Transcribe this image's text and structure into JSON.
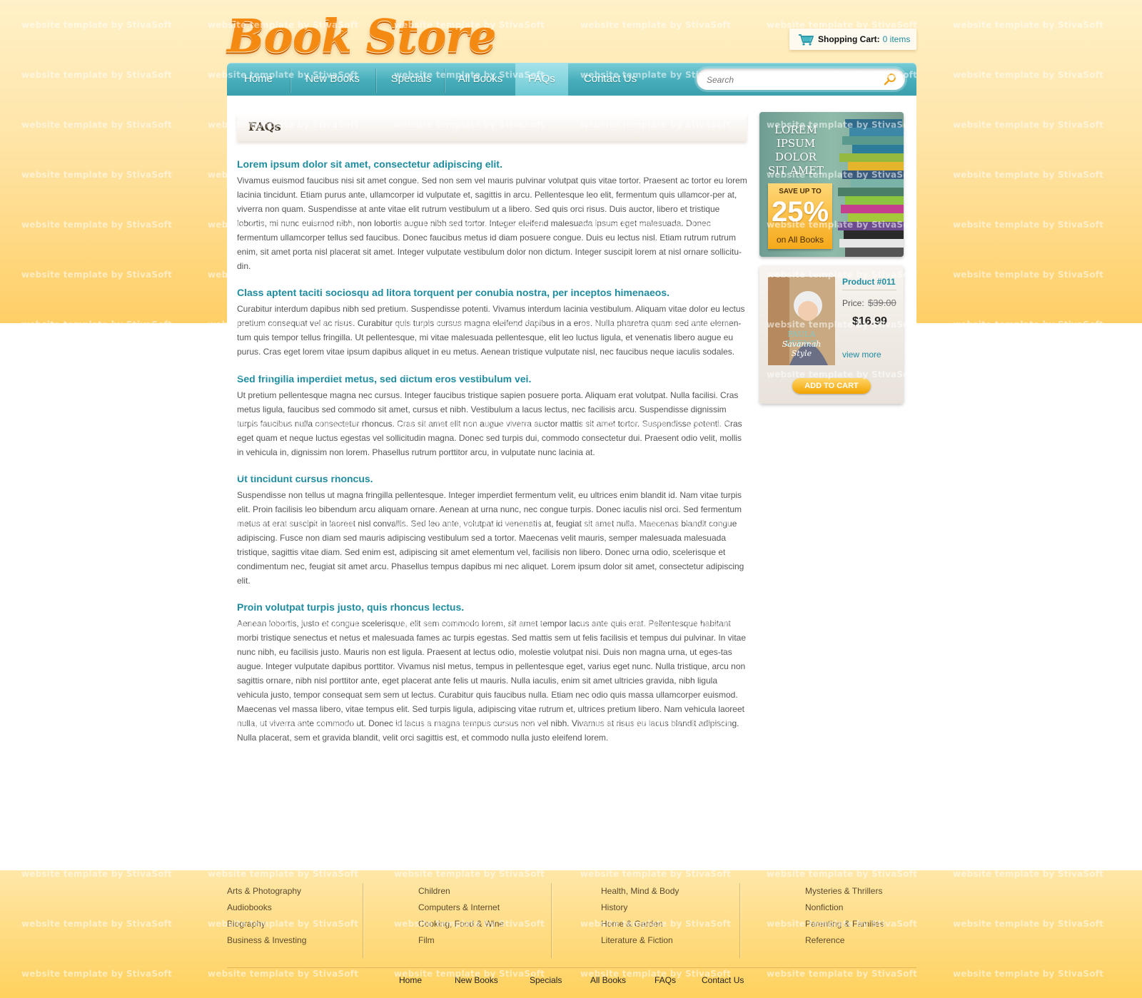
{
  "brand": {
    "logo_text": "Book Store"
  },
  "cart": {
    "label": "Shopping Cart:",
    "count_text": "0 items"
  },
  "nav": {
    "items": [
      {
        "label": "Home"
      },
      {
        "label": "New Books"
      },
      {
        "label": "Specials"
      },
      {
        "label": "All Books"
      },
      {
        "label": "FAQs",
        "active": true
      },
      {
        "label": "Contact Us"
      }
    ],
    "search_placeholder": "Search"
  },
  "page": {
    "title": "FAQs"
  },
  "faqs": [
    {
      "question": "Lorem ipsum dolor sit amet, consectetur adipiscing elit.",
      "answer": "Vivamus euismod faucibus nisi sit amet congue. Sed non sem vel mauris pulvinar volutpat quis vitae tortor. Praesent ac tortor eu lorem lacinia tincidunt. Etiam purus ante, ullamcorper id vulputate et, sagittis in arcu. Pellentesque leo elit, fermentum quis ullamcor-per at, viverra non quam. Suspendisse at ante vitae elit rutrum vestibulum ut a libero. Sed quis orci risus. Duis auctor, libero et tristique lobortis, mi nunc euismod nibh, non lobortis augue nibh sed tortor. Integer eleifend malesuada ipsum eget malesuada. Donec fermentum ullamcorper tellus sed faucibus. Donec faucibus metus id diam posuere congue. Duis eu lectus nisl. Etiam rutrum rutrum enim, sit amet porta nisl placerat sit amet. Integer vulputate vestibulum dolor non dictum. Integer suscipit lorem at nisl ornare sollicitu-din."
    },
    {
      "question": "Class aptent taciti sociosqu ad litora torquent per conubia nostra, per inceptos himenaeos.",
      "answer": "Curabitur interdum dapibus nibh sed pretium. Suspendisse potenti. Vivamus interdum lacinia vestibulum. Aliquam vitae dolor eu lectus pretium consequat vel ac risus. Curabitur quis turpis cursus magna eleifend dapibus in a eros. Nulla pharetra quam sed ante elemen-tum quis tempor tellus fringilla. Ut pellentesque, mi vitae malesuada pellentesque, elit leo luctus ligula, et venenatis libero augue eu purus. Cras eget lorem vitae ipsum dapibus aliquet in eu metus. Aenean tristique vulputate nisl, nec faucibus neque iaculis sodales."
    },
    {
      "question": "Sed fringilla imperdiet metus, sed dictum eros vestibulum vel.",
      "answer": "Ut pretium pellentesque magna nec cursus. Integer faucibus tristique sapien posuere porta. Aliquam erat volutpat. Nulla facilisi. Cras metus ligula, faucibus sed commodo sit amet, cursus et nibh. Vestibulum a lacus lectus, nec facilisis arcu. Suspendisse dignissim turpis faucibus nulla consectetur rhoncus. Cras sit amet elit non augue viverra auctor mattis sit amet tortor. Suspendisse potenti. Cras eget quam et neque luctus egestas vel sollicitudin magna. Donec sed turpis dui, commodo consectetur dui. Praesent odio velit, mollis in vehicula in, dignissim non lorem. Phasellus rutrum porttitor arcu, in vulputate nunc lacinia at."
    },
    {
      "question": "Ut tincidunt cursus rhoncus.",
      "answer": "Suspendisse non tellus ut magna fringilla pellentesque. Integer imperdiet fermentum velit, eu ultrices enim blandit id. Nam vitae turpis elit. Proin facilisis leo bibendum arcu aliquam ornare. Aenean at urna nunc, nec congue turpis. Donec iaculis nisl orci. Sed fermentum metus at erat suscipit in laoreet nisl convallis. Sed leo ante, volutpat id venenatis at, feugiat sit amet nulla. Maecenas blandit congue adipiscing. Fusce non diam sed mauris adipiscing vestibulum sed a tortor. Maecenas velit mauris, semper malesuada malesuada tristique, sagittis vitae diam. Sed enim est, adipiscing sit amet elementum vel, facilisis non libero. Donec urna odio, scelerisque et condimentum nec, feugiat sit amet arcu. Phasellus tempus dapibus mi nec aliquet. Lorem ipsum dolor sit amet, consectetur adipiscing elit."
    },
    {
      "question": "Proin volutpat turpis justo, quis rhoncus lectus.",
      "answer": "Aenean lobortis, justo et congue scelerisque, elit sem commodo lorem, sit amet tempor lacus ante quis erat. Pellentesque habitant morbi tristique senectus et netus et malesuada fames ac turpis egestas. Sed mattis sem ut felis facilisis et tempus dui pulvinar. In vitae nunc nibh, eu facilisis justo. Mauris non est ligula. Praesent at lectus odio, molestie volutpat nisi. Duis non magna urna, ut eges-tas augue. Integer vulputate dapibus porttitor. Vivamus nisl metus, tempus in pellentesque eget, varius eget nunc. Nulla tristique, arcu non sagittis ornare, nibh nisl porttitor ante, eget placerat ante felis ut mauris. Nulla iaculis, enim sit amet ultricies gravida, nibh ligula vehicula justo, tempor consequat sem sem ut lectus. Curabitur quis faucibus nulla. Etiam nec odio quis massa ullamcorper euismod. Maecenas vel massa libero, vitae tempus elit. Sed turpis ligula, adipiscing vitae rutrum et, ultrices pretium libero. Nam vehicula laoreet nulla, ut viverra ante commodo ut. Donec id lacus a magna tempus cursus non vel nibh. Vivamus at risus eu lacus blandit adipiscing. Nulla placerat, sem et gravida blandit, velit orci sagittis est, et commodo nulla justo eleifend lorem."
    }
  ],
  "sidebar": {
    "banner": {
      "title": "LOREM IPSUM DOLOR SIT AMET",
      "save_line": "SAVE UP TO",
      "save_value": "25%",
      "save_suffix": "on All Books"
    },
    "product": {
      "title": "Product #011",
      "price_label": "Price:",
      "old_price": "$39.00",
      "price": "$16.99",
      "view_more": "view more",
      "add_to_cart": "ADD TO CART",
      "cover_author": "PAULA DEEN'S",
      "cover_title": "Savannah Style"
    }
  },
  "footer": {
    "columns": [
      [
        "Arts & Photography",
        "Audiobooks",
        "Biography",
        "Business & Investing"
      ],
      [
        "Children",
        "Computers & Internet",
        "Cooking, Food & Wine",
        "Film"
      ],
      [
        "Health, Mind & Body",
        "History",
        "Home & Garden",
        "Literature & Fiction"
      ],
      [
        "Mysteries & Thrillers",
        "Nonfiction",
        "Parenting & Families",
        "Reference"
      ]
    ],
    "nav": [
      "Home",
      "New Books",
      "Specials",
      "All Books",
      "FAQs",
      "Contact Us"
    ]
  },
  "watermark_text": "website template by StivaSoft",
  "colors": {
    "accent_teal": "#1f8ca0",
    "nav_teal": "#47adba",
    "brand_orange": "#f58a12",
    "bg_yellow": "#ffcf66"
  }
}
